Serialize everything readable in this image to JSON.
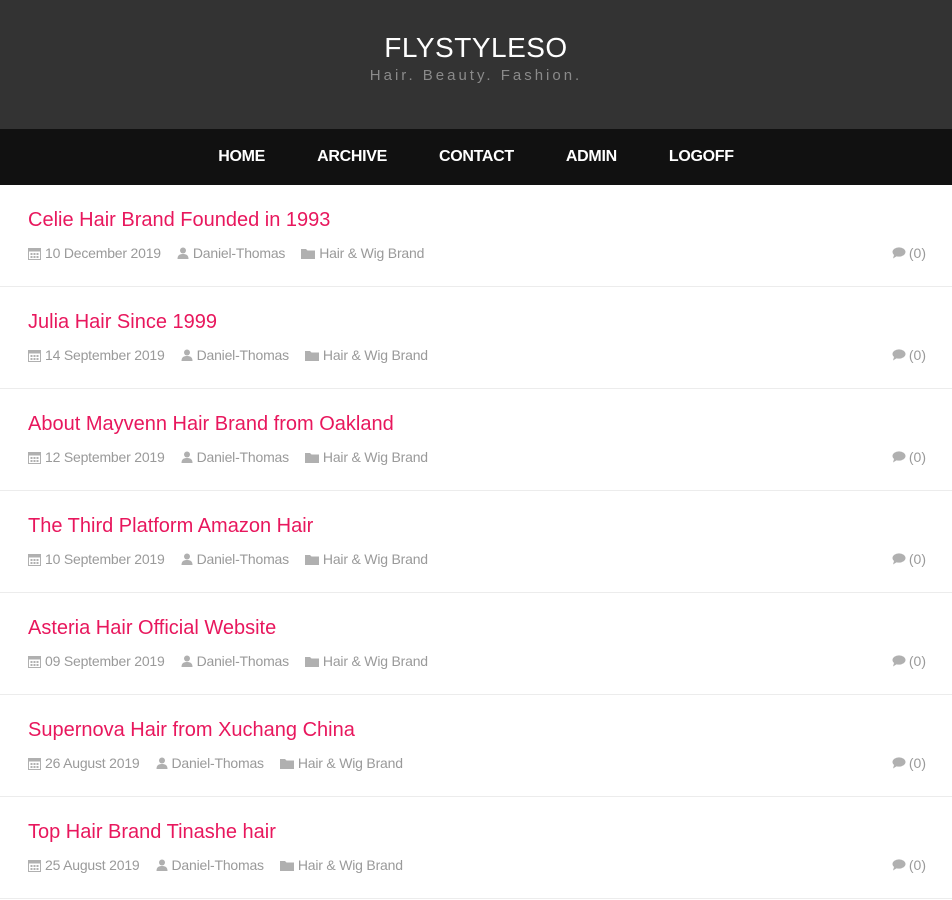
{
  "header": {
    "title": "FLYSTYLESO",
    "tagline": "Hair. Beauty. Fashion."
  },
  "nav": {
    "items": [
      {
        "label": "HOME"
      },
      {
        "label": "ARCHIVE"
      },
      {
        "label": "CONTACT"
      },
      {
        "label": "ADMIN"
      },
      {
        "label": "LOGOFF"
      }
    ]
  },
  "icons": {
    "date": "calendar-icon",
    "author": "user-icon",
    "category": "folder-icon",
    "comments": "comment-icon"
  },
  "colors": {
    "accent": "#e8175d",
    "header_bg": "#333333",
    "nav_bg": "#111111",
    "meta": "#9a9a9a"
  },
  "posts": [
    {
      "title": "Celie Hair Brand Founded in 1993",
      "date": "10 December 2019",
      "author": "Daniel-Thomas",
      "category": "Hair & Wig Brand",
      "comments": "(0)"
    },
    {
      "title": "Julia Hair Since 1999",
      "date": "14 September 2019",
      "author": "Daniel-Thomas",
      "category": "Hair & Wig Brand",
      "comments": "(0)"
    },
    {
      "title": "About Mayvenn Hair Brand from Oakland",
      "date": "12 September 2019",
      "author": "Daniel-Thomas",
      "category": "Hair & Wig Brand",
      "comments": "(0)"
    },
    {
      "title": "The Third Platform Amazon Hair",
      "date": "10 September 2019",
      "author": "Daniel-Thomas",
      "category": "Hair & Wig Brand",
      "comments": "(0)"
    },
    {
      "title": "Asteria Hair Official Website",
      "date": "09 September 2019",
      "author": "Daniel-Thomas",
      "category": "Hair & Wig Brand",
      "comments": "(0)"
    },
    {
      "title": "Supernova Hair from Xuchang China",
      "date": "26 August 2019",
      "author": "Daniel-Thomas",
      "category": "Hair & Wig Brand",
      "comments": "(0)"
    },
    {
      "title": "Top Hair Brand Tinashe hair",
      "date": "25 August 2019",
      "author": "Daniel-Thomas",
      "category": "Hair & Wig Brand",
      "comments": "(0)"
    }
  ]
}
